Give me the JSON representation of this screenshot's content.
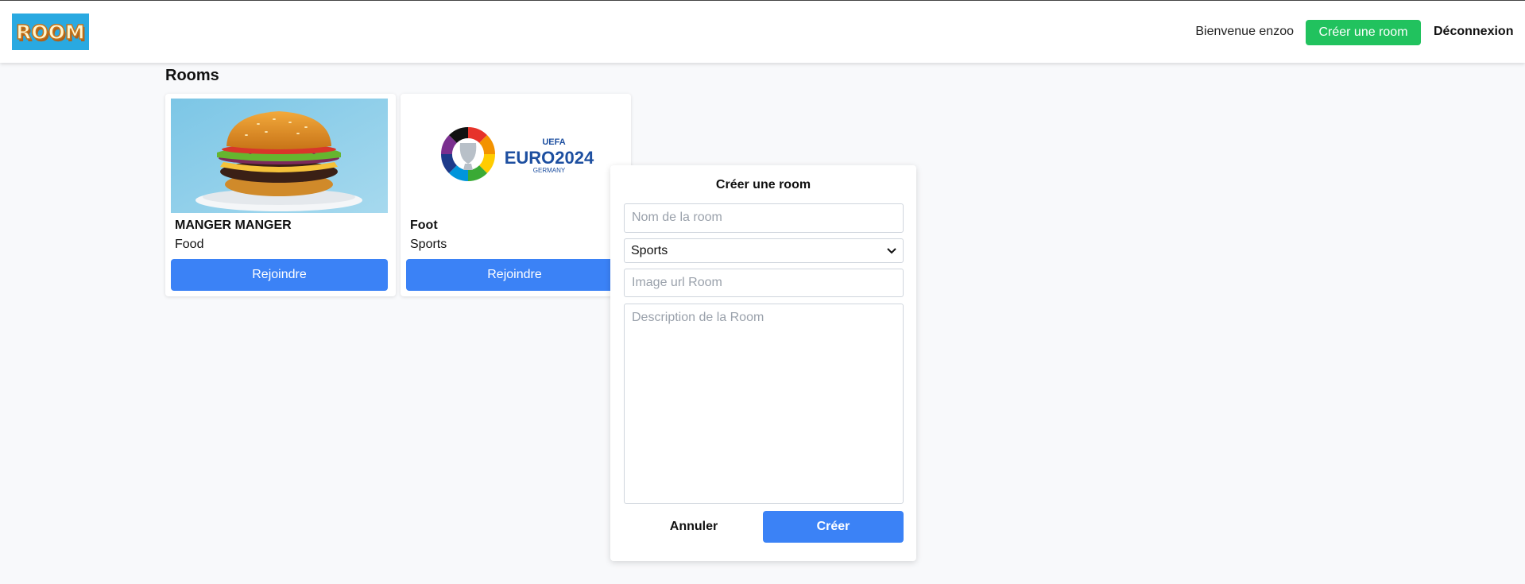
{
  "header": {
    "logo_text": "ROOM",
    "welcome": "Bienvenue enzoo",
    "create_label": "Créer une room",
    "logout_label": "Déconnexion"
  },
  "main": {
    "title": "Rooms",
    "rooms": [
      {
        "name": "MANGER MANGER",
        "category": "Food",
        "join_label": "Rejoindre",
        "image": "burger-image"
      },
      {
        "name": "Foot",
        "category": "Sports",
        "join_label": "Rejoindre",
        "image": "euro-2024-logo",
        "logo_text": [
          "UEFA",
          "EURO2024",
          "GERMANY"
        ]
      }
    ]
  },
  "modal": {
    "title": "Créer une room",
    "name_placeholder": "Nom de la room",
    "category_selected": "Sports",
    "image_placeholder": "Image url Room",
    "description_placeholder": "Description de la Room",
    "cancel_label": "Annuler",
    "submit_label": "Créer"
  },
  "colors": {
    "accent_blue": "#3b82f6",
    "create_green": "#21c25e",
    "background": "#f8f9fb"
  }
}
